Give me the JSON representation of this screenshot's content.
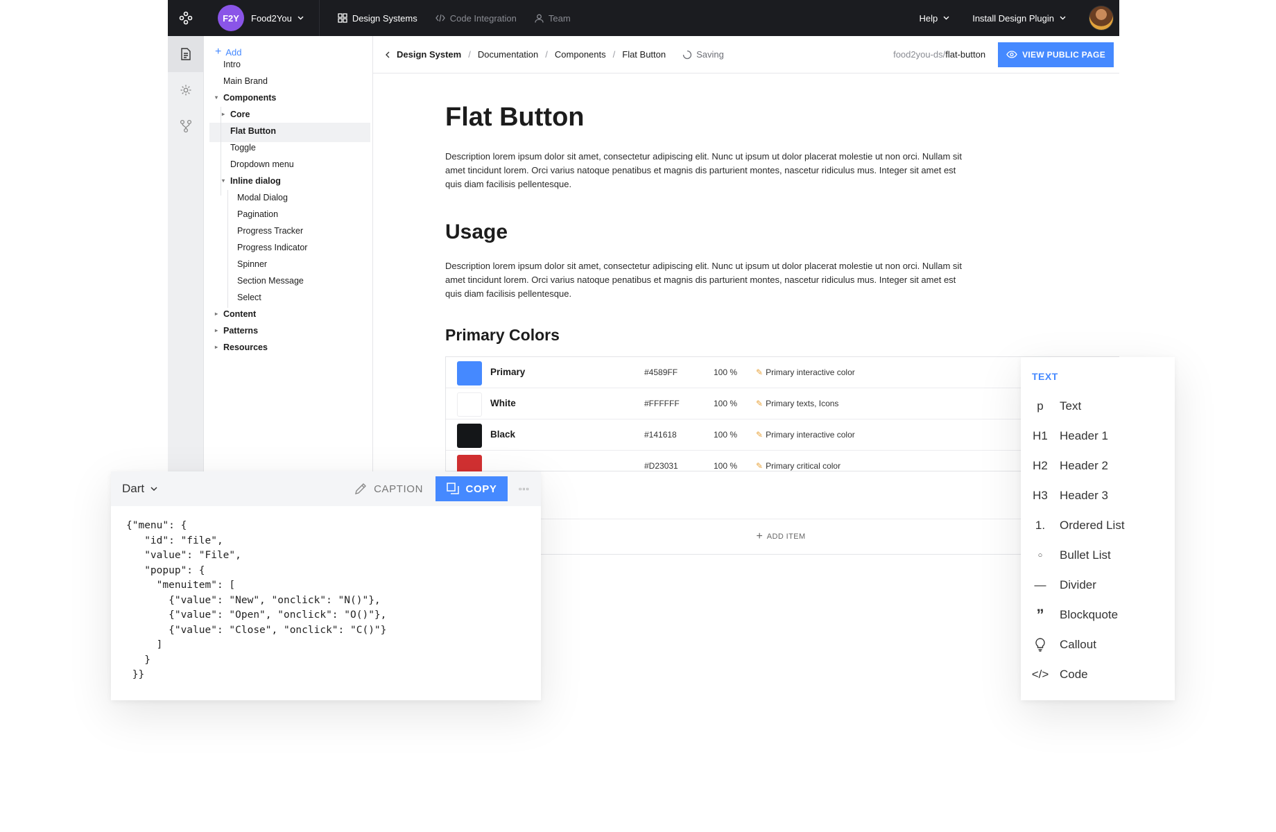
{
  "topbar": {
    "brand_badge": "F2Y",
    "brand_name": "Food2You",
    "nav": [
      {
        "label": "Design Systems"
      },
      {
        "label": "Code Integration"
      },
      {
        "label": "Team"
      }
    ],
    "help": "Help",
    "install": "Install Design Plugin"
  },
  "tree": {
    "add_label": "Add",
    "items": [
      {
        "label": "Intro"
      },
      {
        "label": "Main Brand"
      },
      {
        "label": "Components"
      },
      {
        "label": "Core"
      },
      {
        "label": "Flat Button"
      },
      {
        "label": "Toggle"
      },
      {
        "label": "Dropdown menu"
      },
      {
        "label": "Inline dialog"
      },
      {
        "label": "Modal Dialog"
      },
      {
        "label": "Pagination"
      },
      {
        "label": "Progress Tracker"
      },
      {
        "label": "Progress Indicator"
      },
      {
        "label": "Spinner"
      },
      {
        "label": "Section Message"
      },
      {
        "label": "Select"
      },
      {
        "label": "Content"
      },
      {
        "label": "Patterns"
      },
      {
        "label": "Resources"
      }
    ]
  },
  "breadcrumb": {
    "items": [
      "Design System",
      "Documentation",
      "Components",
      "Flat Button"
    ],
    "saving": "Saving",
    "slug_prefix": "food2you-ds/",
    "slug": "flat-button",
    "view_button": "VIEW PUBLIC PAGE"
  },
  "doc": {
    "title": "Flat Button",
    "description": "Description lorem ipsum dolor sit amet, consectetur adipiscing elit. Nunc ut ipsum ut dolor placerat molestie ut non orci. Nullam sit amet tincidunt lorem. Orci varius natoque penatibus et magnis dis parturient montes, nascetur ridiculus mus. Integer sit amet est quis diam facilisis pellentesque.",
    "usage_title": "Usage",
    "usage_text": "Description lorem ipsum dolor sit amet, consectetur adipiscing elit. Nunc ut ipsum ut dolor placerat molestie ut non orci. Nullam sit amet tincidunt lorem. Orci varius natoque penatibus et magnis dis parturient montes, nascetur ridiculus mus. Integer sit amet est quis diam facilisis pellentesque.",
    "colors_title": "Primary Colors",
    "colors": [
      {
        "name": "Primary",
        "hex": "#4589FF",
        "opacity": "100 %",
        "note": "Primary interactive color",
        "swatch": "#4589ff"
      },
      {
        "name": "White",
        "hex": "#FFFFFF",
        "opacity": "100 %",
        "note": "Primary texts, Icons",
        "swatch": "#ffffff"
      },
      {
        "name": "Black",
        "hex": "#141618",
        "opacity": "100 %",
        "note": "Primary interactive color",
        "swatch": "#141618"
      },
      {
        "name": "",
        "hex": "#D23031",
        "opacity": "100 %",
        "note": "Primary critical color",
        "swatch": "#d23031"
      }
    ],
    "add_item": "ADD ITEM"
  },
  "code_panel": {
    "language": "Dart",
    "caption": "CAPTION",
    "copy": "COPY",
    "more": "▫▫▫",
    "code": "{\"menu\": {\n   \"id\": \"file\",\n   \"value\": \"File\",\n   \"popup\": {\n     \"menuitem\": [\n       {\"value\": \"New\", \"onclick\": \"N()\"},\n       {\"value\": \"Open\", \"onclick\": \"O()\"},\n       {\"value\": \"Close\", \"onclick\": \"C()\"}\n     ]\n   }\n }}"
  },
  "block_menu": {
    "title": "TEXT",
    "items": [
      {
        "icon": "p",
        "label": "Text"
      },
      {
        "icon": "H1",
        "label": "Header 1"
      },
      {
        "icon": "H2",
        "label": "Header 2"
      },
      {
        "icon": "H3",
        "label": "Header 3"
      },
      {
        "icon": "1.",
        "label": "Ordered List"
      },
      {
        "icon": "○",
        "label": "Bullet List"
      },
      {
        "icon": "—",
        "label": "Divider"
      },
      {
        "icon": "”",
        "label": "Blockquote"
      },
      {
        "icon": "lightbulb-icon",
        "label": "Callout"
      },
      {
        "icon": "</>",
        "label": "Code"
      }
    ]
  },
  "colors": {
    "accent": "#4589ff",
    "topbar": "#1b1c20",
    "brand_badge": "#8a55e8"
  }
}
